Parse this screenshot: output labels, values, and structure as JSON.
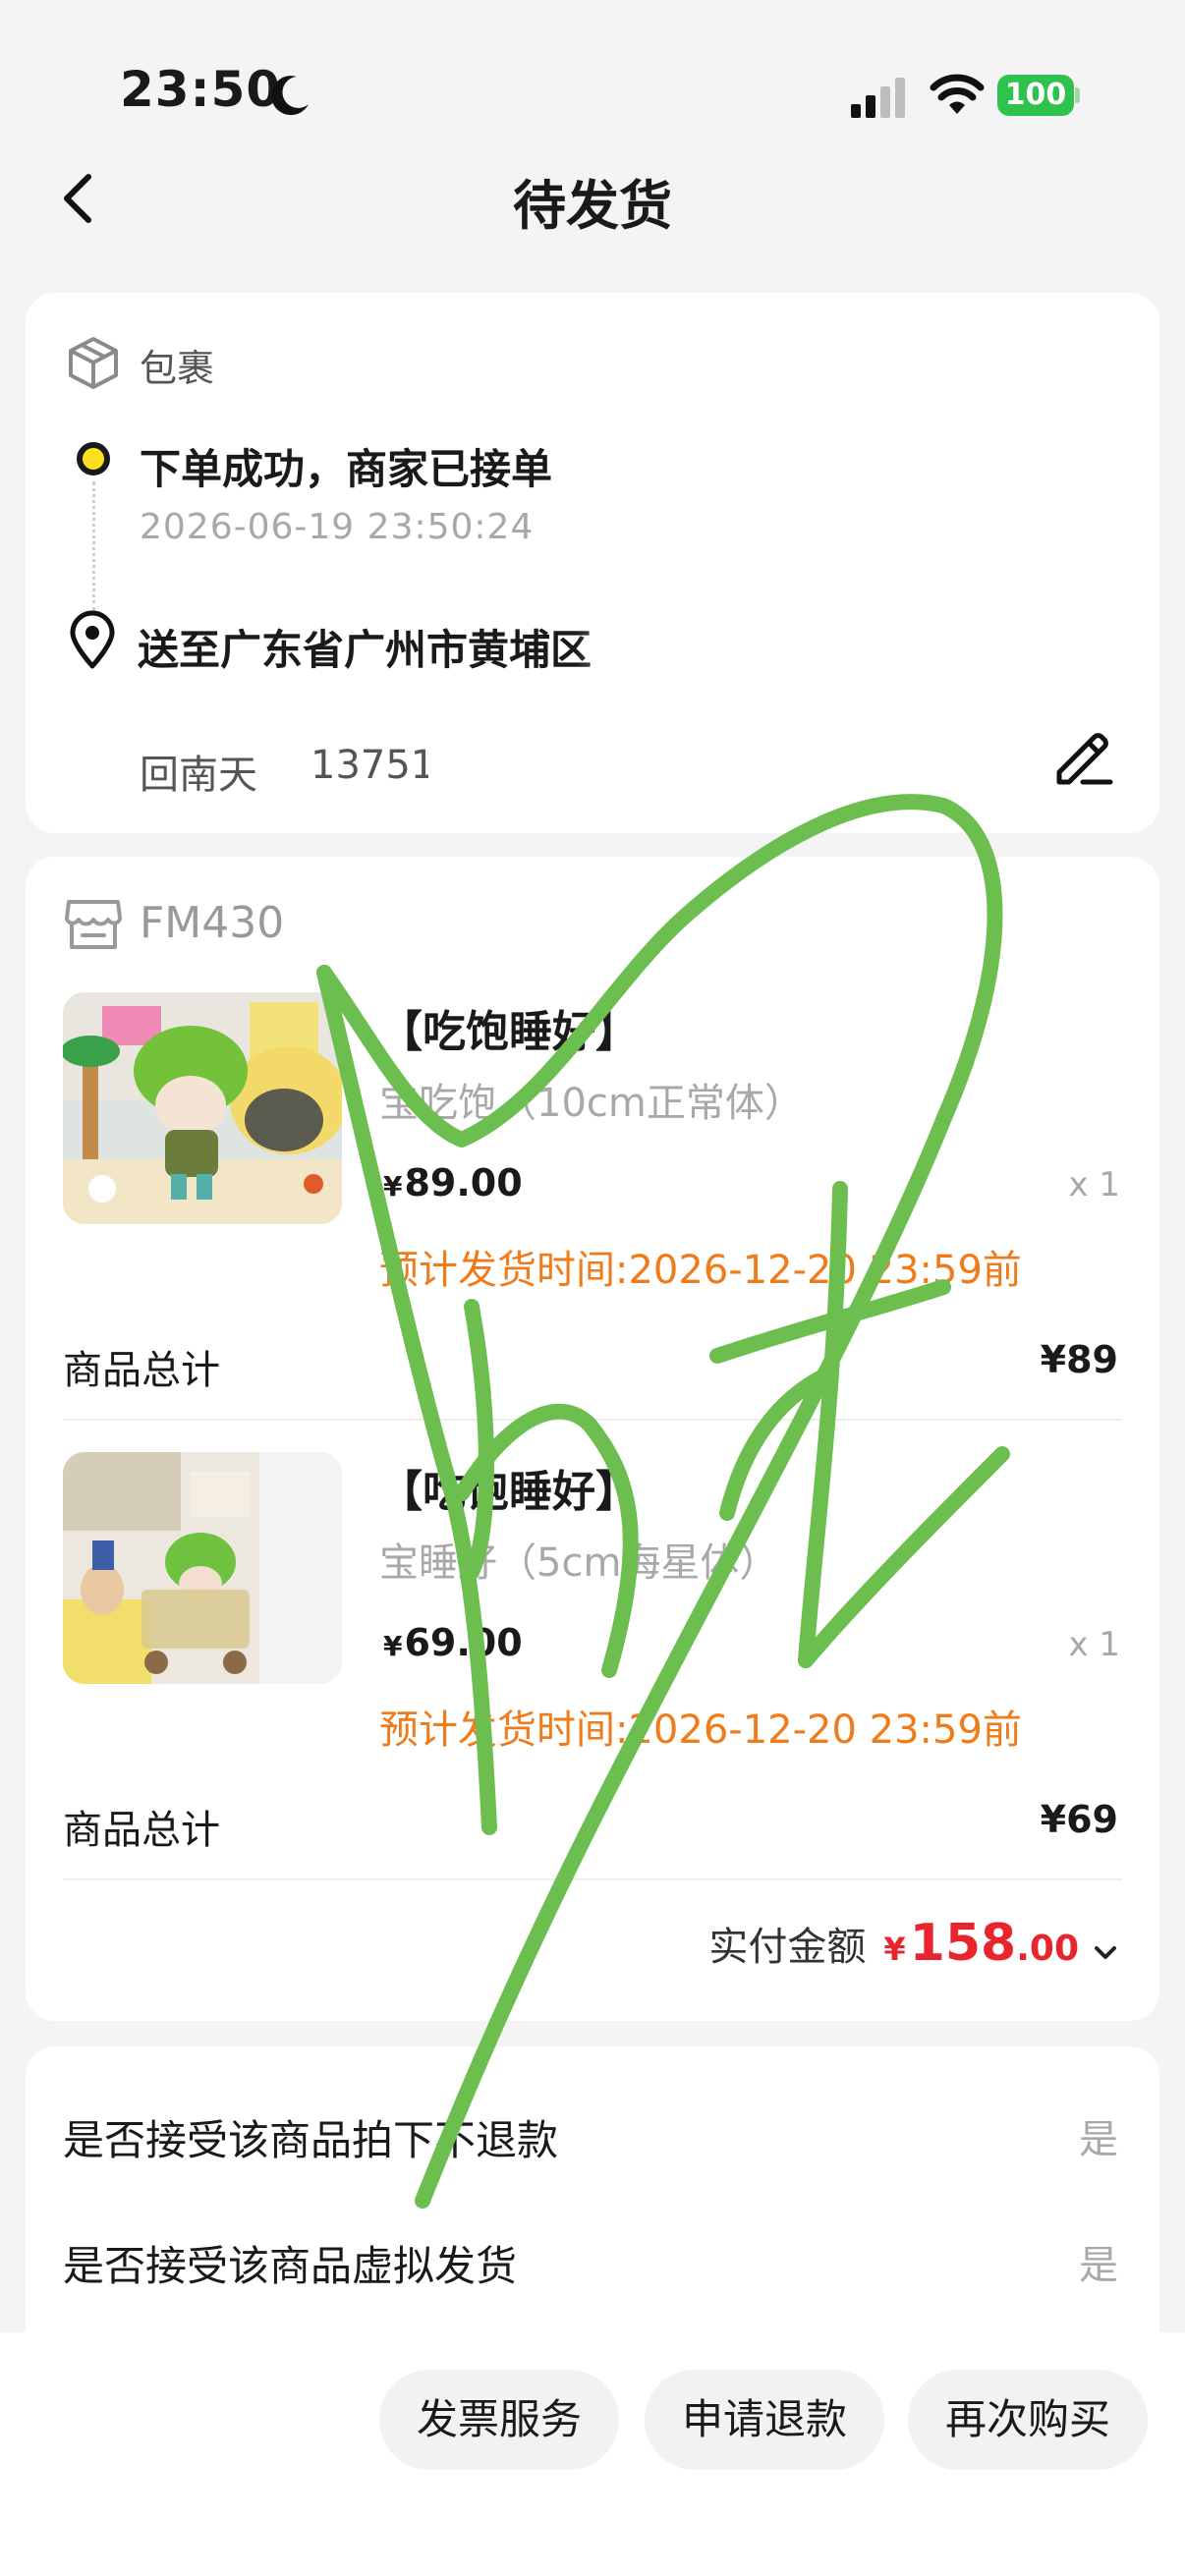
{
  "status_bar": {
    "time": "23:50",
    "battery": "100"
  },
  "nav": {
    "title": "待发货"
  },
  "package": {
    "label": "包裹",
    "status": "下单成功，商家已接单",
    "time": "2026-06-19 23:50:24",
    "address": "送至广东省广州市黄埔区",
    "recipient": "回南天",
    "phone": "13751"
  },
  "order": {
    "shop_name": "FM430",
    "products": [
      {
        "title": "【吃饱睡好】",
        "spec": "宝吃饱（10cm正常体）",
        "price_currency": "¥",
        "price": "89.00",
        "qty": "x 1",
        "eta": "预计发货时间:2026-12-20 23:59前",
        "subtotal_label": "商品总计",
        "subtotal": "¥89"
      },
      {
        "title": "【吃饱睡好】",
        "spec": "宝睡好（5cm海星体）",
        "price_currency": "¥",
        "price": "69.00",
        "qty": "x 1",
        "eta": "预计发货时间:2026-12-20 23:59前",
        "subtotal_label": "商品总计",
        "subtotal": "¥69"
      }
    ],
    "paid_label": "实付金额",
    "paid_currency": "¥",
    "paid_int": "158",
    "paid_dec": ".00"
  },
  "terms": [
    {
      "label": "是否接受该商品拍下不退款",
      "value": "是"
    },
    {
      "label": "是否接受该商品虚拟发货",
      "value": "是"
    }
  ],
  "actions": {
    "invoice": "发票服务",
    "refund": "申请退款",
    "rebuy": "再次购买"
  },
  "colors": {
    "accent_orange": "#f07b1a",
    "price_red": "#e8252c",
    "timeline_yellow": "#ffe020",
    "battery_green": "#2fc24c",
    "scribble_green": "#6cbf4f"
  }
}
